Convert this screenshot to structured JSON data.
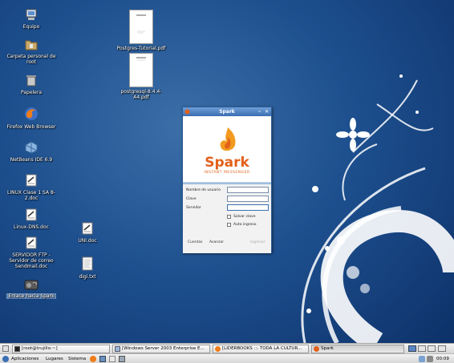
{
  "desktop_icons": {
    "equipo": "Equipo",
    "carpeta": "Carpeta personal de root",
    "papelera": "Papelera",
    "firefox": "Firefox Web Browser",
    "netbeans": "NetBeans IDE 6.9",
    "linux_clase": "LINUX Clase 1 SA 8-2.doc",
    "linux_dns": "Linux-DNS.doc",
    "servidor_ftp": "SERVIDOR FTP - Servidor de correo Sendmail.doc",
    "enlace_spark": "Enlace hacia Spark",
    "uni_doc": "UNI.doc",
    "digi_txt": "digi.txt",
    "postgres_tutorial": "Postgres-Tutorial.pdf",
    "postgresql": "postgresql-8.4.4-A4.pdf"
  },
  "spark_window": {
    "title": "Spark",
    "brand": "Spark",
    "tagline": "INSTANT MESSENGER",
    "username_label": "Nombre de usuario",
    "password_label": "Clave",
    "server_label": "Servidor",
    "save_password_label": "Salvar clave",
    "auto_login_label": "Auto ingreso",
    "accounts_link": "Cuentas",
    "advanced_link": "Avanzar",
    "login_button": "Ingresar",
    "username_value": "",
    "password_value": "",
    "server_value": ""
  },
  "bottom_panel": {
    "tasks": [
      {
        "label": "[root@trujillo:~]"
      },
      {
        "label": "[Windows Server 2003 Enterprise E..."
      },
      {
        "label": "[LIDERBOOKS ::: TODA LA CULTUR..."
      },
      {
        "label": "Spark"
      }
    ]
  },
  "top_panel": {
    "menu_apps": "Aplicaciones",
    "menu_places": "Lugares",
    "menu_system": "Sistema",
    "clock": "00:09"
  },
  "colors": {
    "spark_orange": "#e2601a",
    "desktop_blue": "#1d4f8e"
  }
}
